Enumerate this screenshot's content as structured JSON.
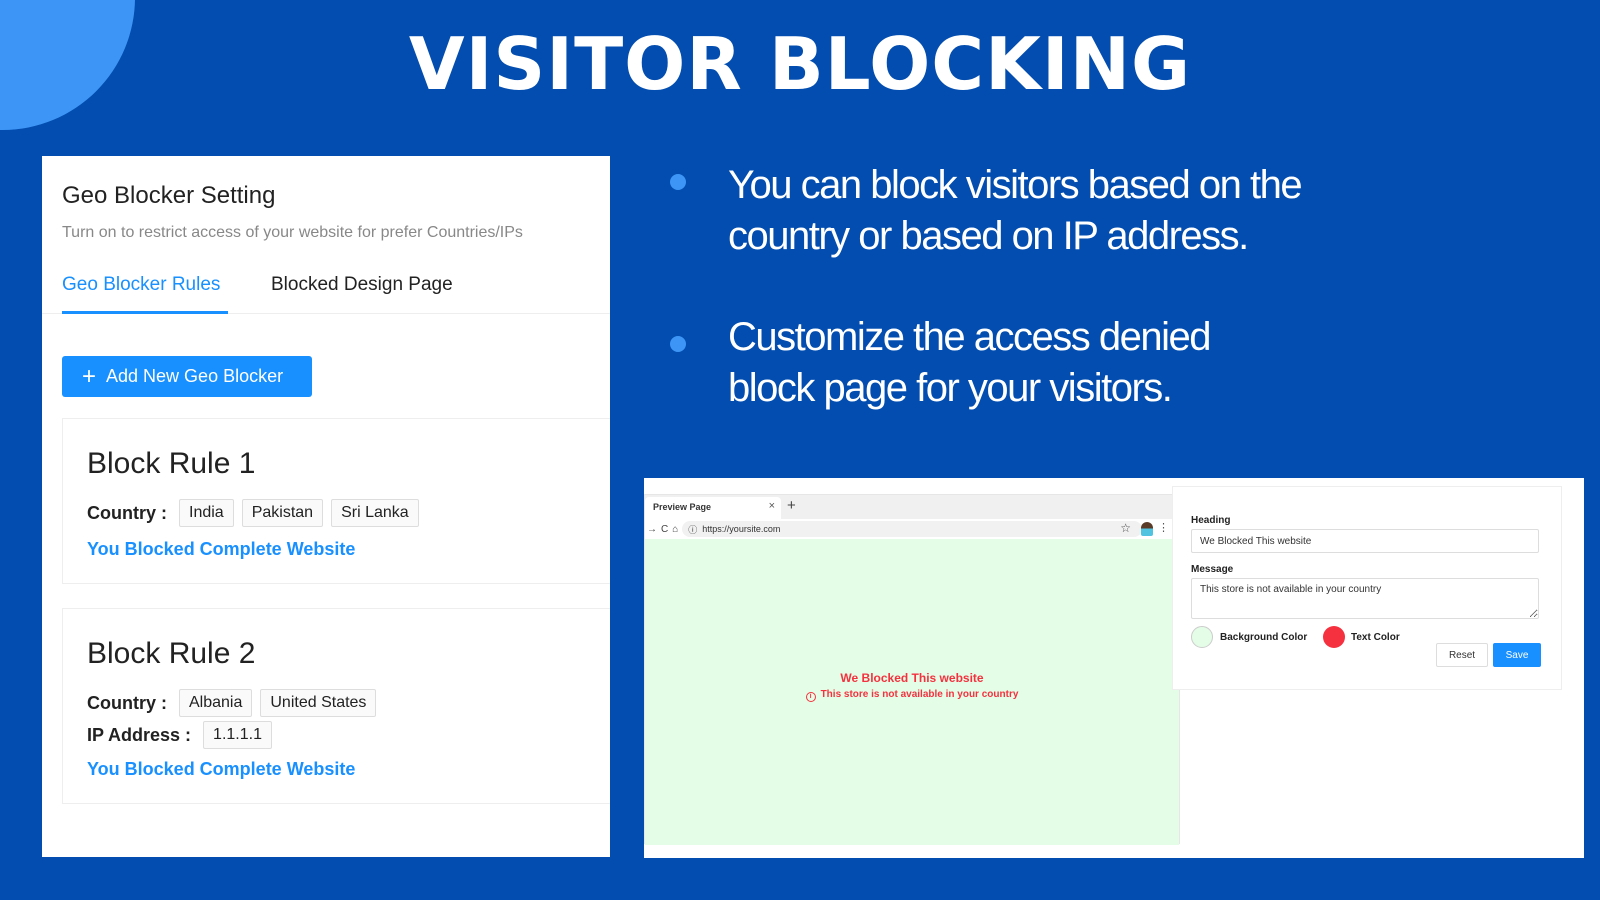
{
  "page": {
    "title": "VISITOR BLOCKING",
    "colors": {
      "background": "#024daf",
      "accent_circle": "#3d96f6",
      "primary": "#1890ff",
      "block_text": "#f5313f",
      "block_bg": "#e3fde6"
    }
  },
  "geo_panel": {
    "title": "Geo Blocker Setting",
    "subtitle": "Turn on to restrict access of your website for prefer Countries/IPs",
    "tabs": [
      {
        "label": "Geo Blocker Rules",
        "active": true
      },
      {
        "label": "Blocked Design Page",
        "active": false
      }
    ],
    "add_button": {
      "icon": "plus-icon",
      "label": "Add New Geo Blocker"
    },
    "rules": [
      {
        "title": "Block Rule 1",
        "country_label": "Country :",
        "countries": [
          "India",
          "Pakistan",
          "Sri Lanka"
        ],
        "link": "You Blocked Complete Website"
      },
      {
        "title": "Block Rule 2",
        "country_label": "Country :",
        "countries": [
          "Albania",
          "United States"
        ],
        "ip_label": "IP Address :",
        "ips": [
          "1.1.1.1"
        ],
        "link": "You Blocked Complete Website"
      }
    ]
  },
  "bullets": [
    "You can block visitors based on the country or based on IP address.",
    "Customize the access denied block page for your visitors."
  ],
  "bullet_lines": [
    [
      "You can block visitors based on the",
      "country or based on IP address."
    ],
    [
      "Customize the access denied",
      "block page for your visitors."
    ]
  ],
  "browser": {
    "tab_title": "Preview Page",
    "tab_close": "×",
    "new_tab": "+",
    "nav_icons": [
      "forward-icon",
      "reload-icon",
      "home-icon",
      "info-icon"
    ],
    "url": "https://yoursite.com",
    "preview": {
      "heading": "We Blocked This website",
      "message": "This store is not available in your country",
      "info_glyph": "i"
    }
  },
  "design_form": {
    "heading_label": "Heading",
    "heading_value": "We Blocked This website",
    "message_label": "Message",
    "message_value": "This store is not available in your country",
    "background_color_label": "Background Color",
    "background_color": "#e3fde6",
    "text_color_label": "Text Color",
    "text_color": "#f5313f",
    "reset_label": "Reset",
    "save_label": "Save"
  }
}
